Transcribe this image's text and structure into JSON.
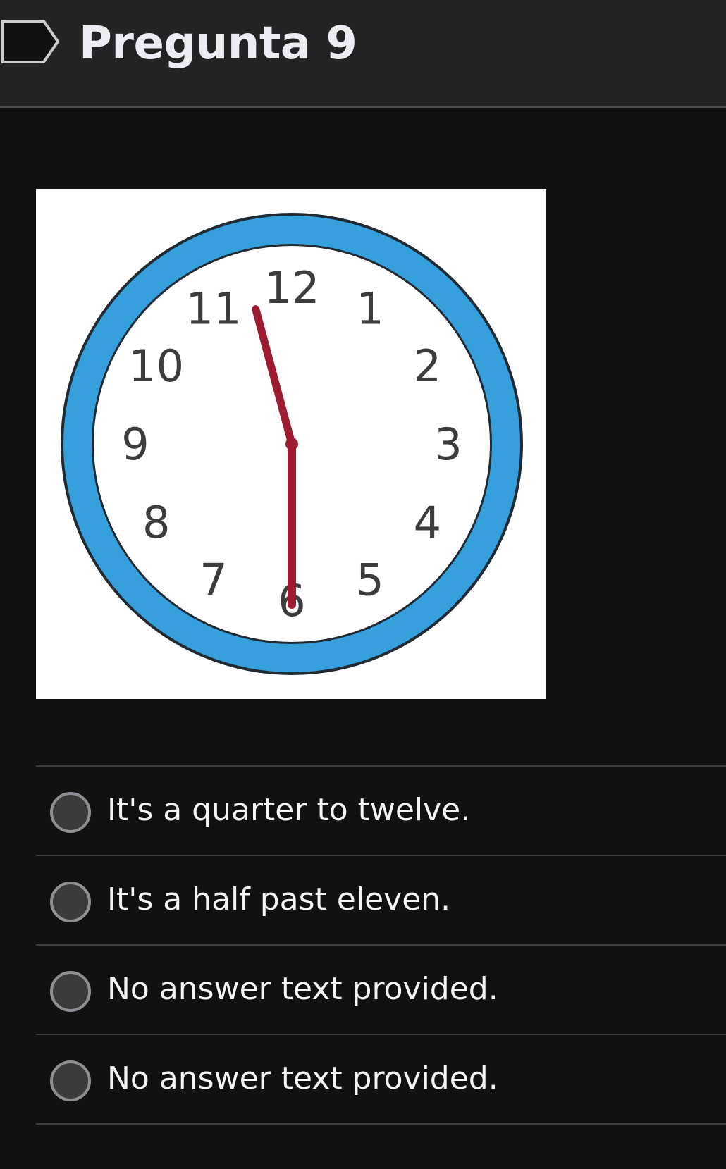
{
  "question": {
    "title": "Pregunta 9",
    "flag_icon": "flag-icon"
  },
  "clock": {
    "numerals": [
      "12",
      "1",
      "2",
      "3",
      "4",
      "5",
      "6",
      "7",
      "8",
      "9",
      "10",
      "11"
    ],
    "time_shown": "11:30",
    "rim_color": "#35a0dc",
    "hand_color": "#9e1b32"
  },
  "answers": [
    {
      "label": "It's a quarter to twelve.",
      "selected": false
    },
    {
      "label": "It's a half past eleven.",
      "selected": false
    },
    {
      "label": "No answer text provided.",
      "selected": false
    },
    {
      "label": "No answer text provided.",
      "selected": false
    }
  ]
}
